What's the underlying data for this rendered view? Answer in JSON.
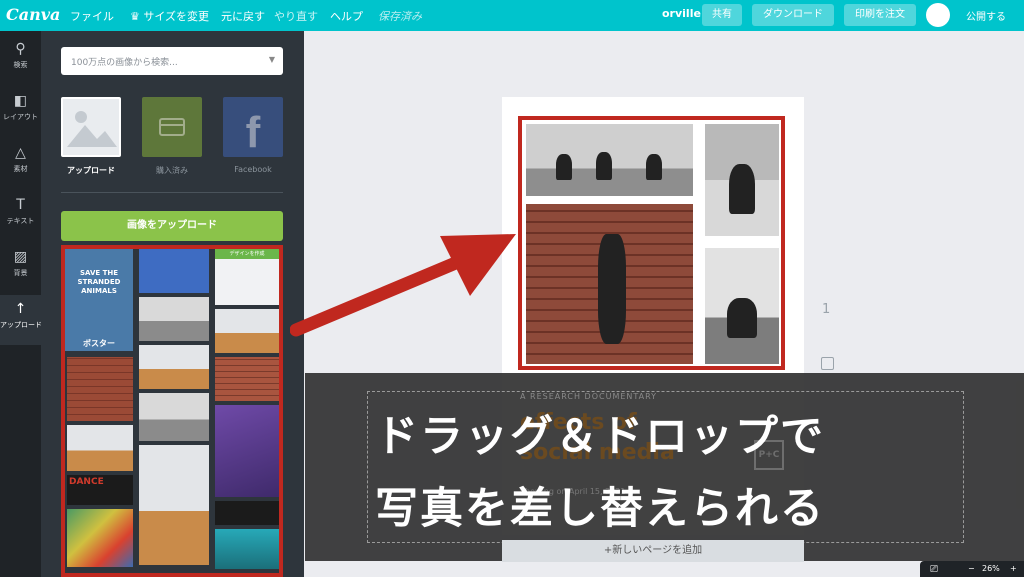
{
  "topbar": {
    "logo": "Canva",
    "menu": [
      "ファイル",
      "♛ サイズを変更",
      "元に戻す",
      "やり直す",
      "ヘルプ"
    ],
    "saved": "保存済み",
    "user": "orville",
    "share": "共有",
    "download": "ダウンロード",
    "print": "印刷を注文",
    "publish": "公開する",
    "color": "#00c4cc"
  },
  "leftnav": [
    {
      "icon": "search-icon",
      "label": "検索"
    },
    {
      "icon": "layout-icon",
      "label": "レイアウト"
    },
    {
      "icon": "elements-icon",
      "label": "素材"
    },
    {
      "icon": "text-icon",
      "label": "テキスト"
    },
    {
      "icon": "background-icon",
      "label": "背景"
    },
    {
      "icon": "upload-icon",
      "label": "アップロード"
    }
  ],
  "panel": {
    "search_placeholder": "100万点の画像から検索...",
    "sources": [
      "アップロード",
      "購入済み",
      "Facebook"
    ],
    "upload_button": "画像をアップロード",
    "poster_title": "SAVE THE STRANDED ANIMALS",
    "poster_label": "ポスター",
    "calendar_title": "デザインを作成",
    "graffiti_text": "DANCE"
  },
  "canvas": {
    "page_number": "1",
    "add_page": "+新しいページを追加",
    "doc_label": "A RESEARCH DOCUMENTARY",
    "doc_title_1": "effects of",
    "doc_title_2": "social media",
    "doc_info": "Showing on April 15, 2021",
    "logo": "P+C"
  },
  "overlay": {
    "line1": "ドラッグ＆ドロップで",
    "line2": "写真を差し替えられる"
  },
  "zoom": {
    "minus": "−",
    "level": "26%",
    "plus": "+"
  },
  "colors": {
    "accent": "#00c4cc",
    "highlight": "#c0281f",
    "upload": "#8bc34a"
  }
}
